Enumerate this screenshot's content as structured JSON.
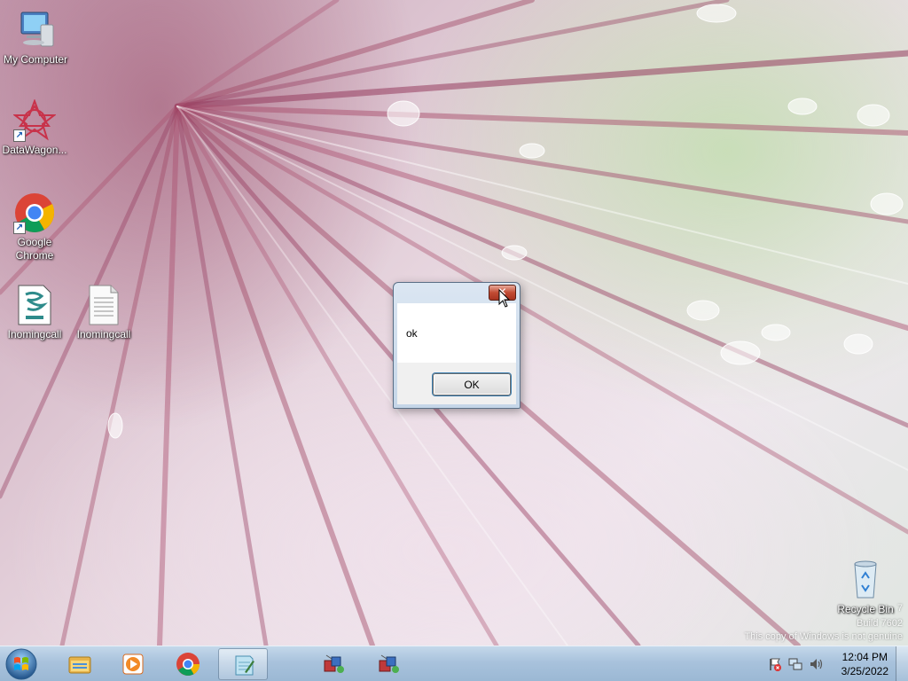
{
  "desktop": {
    "icons": [
      {
        "label": "My Computer",
        "icon": "computer-icon"
      },
      {
        "label": "DataWagon...",
        "icon": "datawagon-icon"
      },
      {
        "label": "Google Chrome",
        "icon": "chrome-icon"
      },
      {
        "label": "Inomingcall",
        "icon": "script-file-icon"
      },
      {
        "label": "Inomingcall",
        "icon": "text-file-icon"
      },
      {
        "label": "Recycle Bin",
        "icon": "recycle-bin-icon"
      }
    ],
    "watermark": {
      "line1": "7",
      "line2": "Build 7602",
      "line3": "This copy of Windows is not genuine"
    }
  },
  "dialog": {
    "title": "",
    "close_label": "✕",
    "message": "ok",
    "ok_label": "OK"
  },
  "taskbar": {
    "items": [
      {
        "icon": "windows-start-icon"
      },
      {
        "icon": "file-explorer-icon"
      },
      {
        "icon": "media-player-icon"
      },
      {
        "icon": "chrome-icon"
      },
      {
        "icon": "notepad-icon",
        "active": true
      },
      {
        "icon": "vb-app-icon"
      },
      {
        "icon": "vb-app-icon"
      }
    ],
    "tray": {
      "icons": [
        "action-center-flag-icon",
        "network-icon",
        "volume-icon"
      ],
      "time": "12:04 PM",
      "date": "3/25/2022"
    }
  },
  "colors": {
    "taskbar_top": "#c4d8ea",
    "taskbar_bottom": "#9bb8d4",
    "close_button": "#c24b33",
    "dialog_frame": "#c5d6e8"
  }
}
